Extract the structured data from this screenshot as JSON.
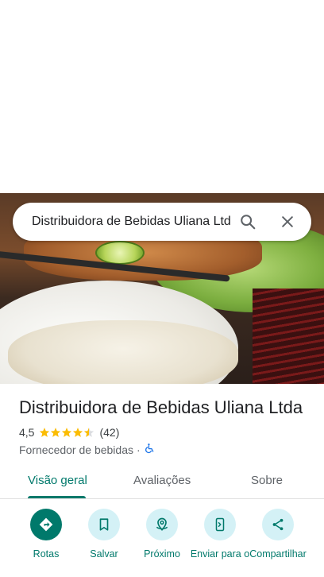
{
  "search": {
    "query": "Distribuidora de Bebidas Uliana Ltda"
  },
  "place": {
    "name": "Distribuidora de Bebidas Uliana Ltda",
    "rating": "4,5",
    "rating_value": 4.5,
    "review_count": "(42)",
    "category": "Fornecedor de bebidas",
    "separator": "·"
  },
  "tabs": [
    {
      "label": "Visão geral",
      "active": true
    },
    {
      "label": "Avaliações",
      "active": false
    },
    {
      "label": "Sobre",
      "active": false
    }
  ],
  "actions": [
    {
      "label": "Rotas",
      "icon": "directions-icon"
    },
    {
      "label": "Salvar",
      "icon": "bookmark-icon"
    },
    {
      "label": "Próximo",
      "icon": "nearby-icon"
    },
    {
      "label": "Enviar para o",
      "icon": "send-to-phone-icon"
    },
    {
      "label": "Compartilhar",
      "icon": "share-icon"
    }
  ],
  "colors": {
    "accent": "#00796b",
    "action_bg": "#d4f1f6",
    "star": "#fbbc04"
  }
}
